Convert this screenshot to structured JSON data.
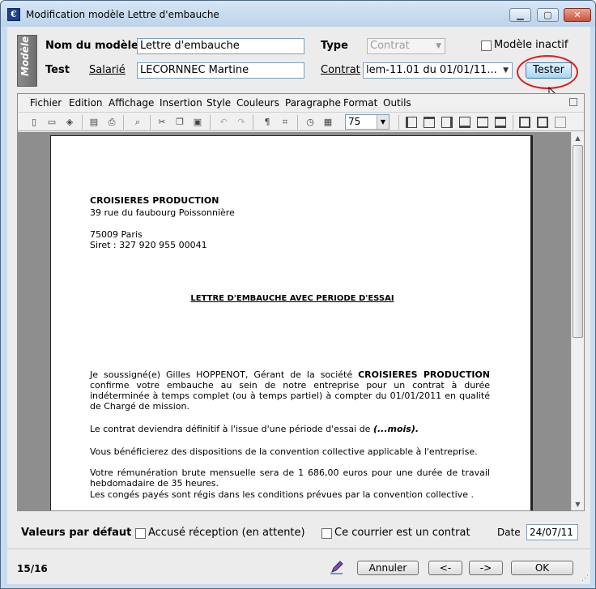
{
  "window": {
    "title": "Modification modèle Lettre d'embauche",
    "icon_glyph": "€"
  },
  "header": {
    "side_tab": "Modèle",
    "nom_label": "Nom du modèle",
    "nom_value": "Lettre d'embauche",
    "type_label": "Type",
    "type_value": "Contrat",
    "inactive_label": "Modèle inactif",
    "test_label": "Test",
    "salarie_link": "Salarié",
    "salarie_value": "LECORNNEC Martine",
    "contrat_link": "Contrat",
    "contrat_value": "lem-11.01 du 01/01/11...",
    "tester_button": "Tester"
  },
  "editor": {
    "menu": [
      "Fichier",
      "Edition",
      "Affichage",
      "Insertion",
      "Style",
      "Couleurs",
      "Paragraphe",
      "Format",
      "Outils"
    ],
    "zoom": "75",
    "document": {
      "company": "CROISIERES PRODUCTION",
      "address1": "39 rue du faubourg Poissonnière",
      "address2": "75009 Paris",
      "siret": "Siret : 327 920 955 00041",
      "title": "LETTRE D'EMBAUCHE AVEC PERIODE D'ESSAI",
      "p1_start": "Je soussigné(e) Gilles HOPPENOT, Gérant de la société ",
      "p1_company": "CROISIERES PRODUCTION",
      "p1_rest": " confirme votre embauche au sein de notre entreprise pour un contrat à durée indéterminée à temps complet (ou à temps partiel) à compter du 01/01/2011 en qualité de Chargé de mission.",
      "p2_start": "Le contrat deviendra définitif à l'issue d'une période d'essai de ",
      "p2_bold": "(...mois).",
      "p3": "Vous bénéficierez des dispositions de la convention collective  applicable à l'entreprise.",
      "p4": "Votre rémunération brute mensuelle sera de 1 686,00 euros pour une durée de travail hebdomadaire de 35 heures.",
      "p5": "Les congés payés sont régis dans les conditions prévues par la convention collective ."
    }
  },
  "defaults": {
    "label": "Valeurs par défaut",
    "accuse": "Accusé réception (en attente)",
    "courrier": "Ce courrier est un contrat",
    "date_label": "Date",
    "date_value": "24/07/11"
  },
  "footer": {
    "counter": "15/16",
    "cancel": "Annuler",
    "prev": "<-",
    "next": "->",
    "ok": "OK"
  }
}
